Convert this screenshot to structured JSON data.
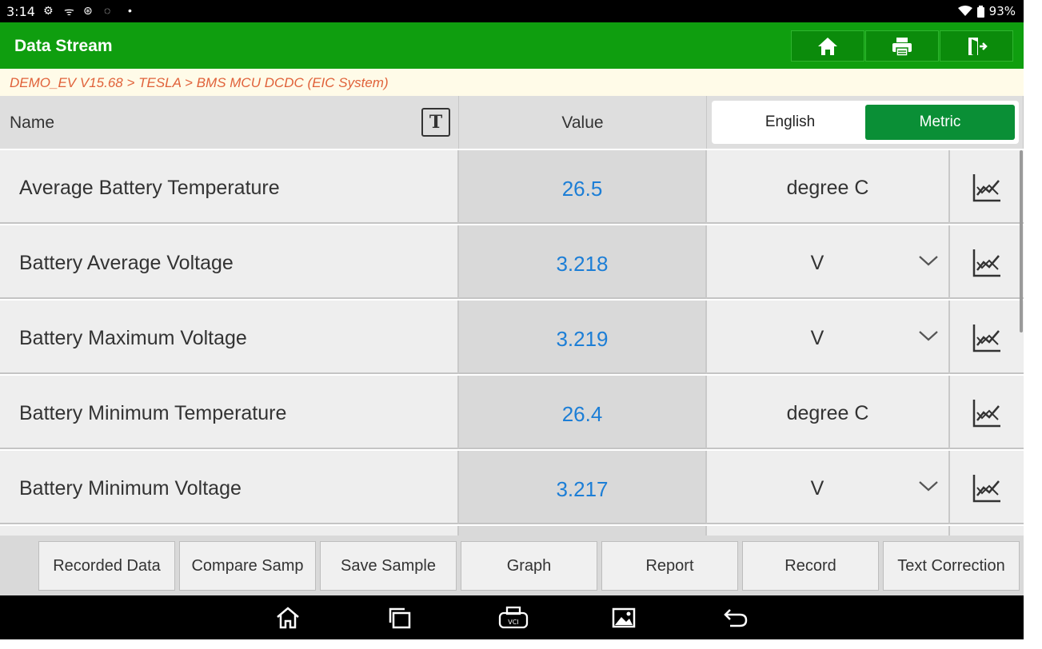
{
  "status_bar": {
    "time": "3:14",
    "battery": "93%"
  },
  "header": {
    "title": "Data Stream",
    "buttons": [
      "home-icon",
      "print-icon",
      "exit-icon"
    ]
  },
  "breadcrumb": "DEMO_EV V15.68 > TESLA > BMS MCU DCDC (EIC System)",
  "table": {
    "col_name": "Name",
    "col_value": "Value",
    "text_toggle": "T",
    "unit_toggle": {
      "english": "English",
      "metric": "Metric",
      "selected": "Metric"
    },
    "rows": [
      {
        "name": "Average Battery Temperature",
        "value": "26.5",
        "unit": "degree C",
        "has_dropdown": false
      },
      {
        "name": "Battery Average Voltage",
        "value": "3.218",
        "unit": "V",
        "has_dropdown": true
      },
      {
        "name": "Battery Maximum Voltage",
        "value": "3.219",
        "unit": "V",
        "has_dropdown": true
      },
      {
        "name": "Battery Minimum Temperature",
        "value": "26.4",
        "unit": "degree C",
        "has_dropdown": false
      },
      {
        "name": "Battery Minimum Voltage",
        "value": "3.217",
        "unit": "V",
        "has_dropdown": true
      }
    ]
  },
  "actions": {
    "recorded_data": "Recorded Data",
    "compare_samp": "Compare Samp",
    "save_sample": "Save Sample",
    "graph": "Graph",
    "report": "Report",
    "record": "Record",
    "text_correction": "Text Correction"
  },
  "colors": {
    "title_bar": "#0f9e0f",
    "metric_selected": "#0a8f36",
    "value_text": "#1c7ed6",
    "breadcrumb_text": "#e0623a"
  }
}
